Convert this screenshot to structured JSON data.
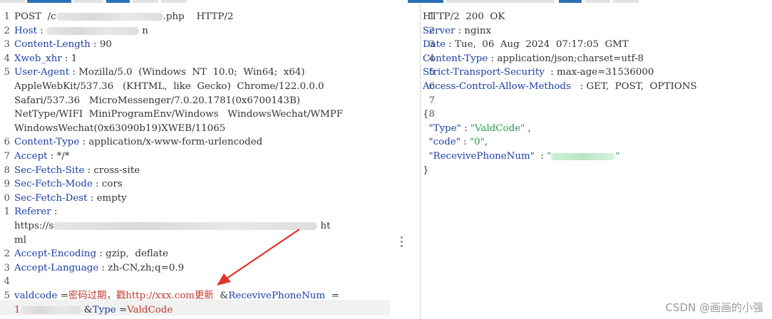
{
  "request": {
    "lines": [
      {
        "n": "1",
        "parts": [
          {
            "t": "POST  /c",
            "c": "val"
          },
          {
            "blur": 150
          },
          {
            "t": ".php    HTTP/2",
            "c": "val"
          }
        ]
      },
      {
        "n": "2",
        "parts": [
          {
            "t": "Host",
            "c": "hname"
          },
          {
            "t": " : ",
            "c": "val"
          },
          {
            "blur": 130
          },
          {
            "t": " n",
            "c": "val"
          }
        ]
      },
      {
        "n": "3",
        "parts": [
          {
            "t": "Content-Length",
            "c": "hname"
          },
          {
            "t": " : 90",
            "c": "val"
          }
        ]
      },
      {
        "n": "4",
        "parts": [
          {
            "t": "Xweb_xhr",
            "c": "hname"
          },
          {
            "t": " : 1",
            "c": "val"
          }
        ]
      },
      {
        "n": "5",
        "parts": [
          {
            "t": "User-Agent",
            "c": "hname"
          },
          {
            "t": " : Mozilla/5.0  (Windows  NT  10.0;  Win64;  x64)",
            "c": "val"
          }
        ]
      },
      {
        "n": "",
        "parts": [
          {
            "t": "AppleWebKit/537.36   (KHTML,  like  Gecko)  Chrome/122.0.0.0",
            "c": "val"
          }
        ]
      },
      {
        "n": "",
        "parts": [
          {
            "t": "Safari/537.36   MicroMessenger/7.0.20.1781(0x6700143B)",
            "c": "val"
          }
        ]
      },
      {
        "n": "",
        "parts": [
          {
            "t": "NetType/WIFI  MiniProgramEnv/Windows   WindowsWechat/WMPF",
            "c": "val"
          }
        ]
      },
      {
        "n": "",
        "parts": [
          {
            "t": "WindowsWechat(0x63090b19)XWEB/11065",
            "c": "val"
          }
        ]
      },
      {
        "n": "6",
        "parts": [
          {
            "t": "Content-Type",
            "c": "hname"
          },
          {
            "t": " : application/x-www-form-urlencoded",
            "c": "val"
          }
        ]
      },
      {
        "n": "7",
        "parts": [
          {
            "t": "Accept",
            "c": "hname"
          },
          {
            "t": " : */*",
            "c": "val"
          }
        ]
      },
      {
        "n": "8",
        "parts": [
          {
            "t": "Sec-Fetch-Site",
            "c": "hname"
          },
          {
            "t": " : cross-site",
            "c": "val"
          }
        ]
      },
      {
        "n": "9",
        "parts": [
          {
            "t": "Sec-Fetch-Mode",
            "c": "hname"
          },
          {
            "t": " : cors",
            "c": "val"
          }
        ]
      },
      {
        "n": "0",
        "parts": [
          {
            "t": "Sec-Fetch-Dest",
            "c": "hname"
          },
          {
            "t": " : empty",
            "c": "val"
          }
        ]
      },
      {
        "n": "1",
        "parts": [
          {
            "t": "Referer",
            "c": "hname"
          },
          {
            "t": " :",
            "c": "val"
          }
        ]
      },
      {
        "n": "",
        "parts": [
          {
            "t": "https://s",
            "c": "val"
          },
          {
            "blur": 370
          },
          {
            "t": " ht",
            "c": "val"
          }
        ]
      },
      {
        "n": "",
        "parts": [
          {
            "t": "ml",
            "c": "val"
          }
        ]
      },
      {
        "n": "2",
        "parts": [
          {
            "t": "Accept-Encoding",
            "c": "hname"
          },
          {
            "t": " : gzip,  deflate",
            "c": "val"
          }
        ]
      },
      {
        "n": "3",
        "parts": [
          {
            "t": "Accept-Language",
            "c": "hname"
          },
          {
            "t": " : zh-CN,zh;q=0.9",
            "c": "val"
          }
        ]
      },
      {
        "n": "4",
        "parts": []
      },
      {
        "n": "5",
        "parts": [
          {
            "t": "valdcode",
            "c": "hname"
          },
          {
            "t": " =",
            "c": "val"
          },
          {
            "t": "密码过期，戳http://xxx.com更新",
            "c": "red"
          },
          {
            "t": "  &",
            "c": "val"
          },
          {
            "t": "RecevivePhoneNum",
            "c": "hname"
          },
          {
            "t": "  =",
            "c": "val"
          }
        ]
      },
      {
        "n": "",
        "parts": [
          {
            "t": "1",
            "c": "red"
          },
          {
            "blur": 85
          },
          {
            "t": " &",
            "c": "val"
          },
          {
            "t": "Type",
            "c": "hname"
          },
          {
            "t": " =",
            "c": "val"
          },
          {
            "t": "ValdCode",
            "c": "red"
          }
        ]
      }
    ]
  },
  "response": {
    "lines": [
      {
        "n": "1",
        "parts": [
          {
            "t": "HTTP/2  200  OK",
            "c": "val"
          }
        ]
      },
      {
        "n": "2",
        "parts": [
          {
            "t": "Server",
            "c": "hname"
          },
          {
            "t": " : nginx",
            "c": "val"
          }
        ]
      },
      {
        "n": "3",
        "parts": [
          {
            "t": "Date",
            "c": "hname"
          },
          {
            "t": " : Tue,  06  Aug  2024  07:17:05  GMT",
            "c": "val"
          }
        ]
      },
      {
        "n": "4",
        "parts": [
          {
            "t": "Content-Type",
            "c": "hname"
          },
          {
            "t": " : application/json;charset=utf-8",
            "c": "val"
          }
        ]
      },
      {
        "n": "5",
        "parts": [
          {
            "t": "Strict-Transport-Security",
            "c": "hname"
          },
          {
            "t": "  : max-age=31536000",
            "c": "val"
          }
        ]
      },
      {
        "n": "6",
        "parts": [
          {
            "t": "Access-Control-Allow-Methods",
            "c": "hname"
          },
          {
            "t": "   : GET,  POST,  OPTIONS",
            "c": "val"
          }
        ]
      },
      {
        "n": "7",
        "parts": []
      },
      {
        "n": "8",
        "parts": [
          {
            "t": "{",
            "c": "val"
          }
        ]
      },
      {
        "n": "",
        "parts": [
          {
            "t": "  ",
            "c": "val"
          },
          {
            "t": "\"Type\"",
            "c": "key"
          },
          {
            "t": " : ",
            "c": "val"
          },
          {
            "t": "\"ValdCode\"",
            "c": "str"
          },
          {
            "t": " ,",
            "c": "val"
          }
        ]
      },
      {
        "n": "",
        "parts": [
          {
            "t": "  ",
            "c": "val"
          },
          {
            "t": "\"code\"",
            "c": "key"
          },
          {
            "t": " : ",
            "c": "val"
          },
          {
            "t": "\"0\"",
            "c": "str"
          },
          {
            "t": ",",
            "c": "val"
          }
        ]
      },
      {
        "n": "",
        "parts": [
          {
            "t": "  ",
            "c": "val"
          },
          {
            "t": "\"RecevivePhoneNum\"",
            "c": "key"
          },
          {
            "t": "  : ",
            "c": "val"
          },
          {
            "t": "\"",
            "c": "str"
          },
          {
            "blurg": 90
          },
          {
            "t": "\"",
            "c": "str"
          }
        ]
      },
      {
        "n": "",
        "parts": [
          {
            "t": "}",
            "c": "val"
          }
        ]
      }
    ]
  },
  "watermark": "CSDN @画画的小强",
  "colors": {
    "header_name": "#1b3fa6",
    "string": "#2b9b4a",
    "highlight": "#c0392b",
    "tab_blue": "#2a6fb8"
  }
}
